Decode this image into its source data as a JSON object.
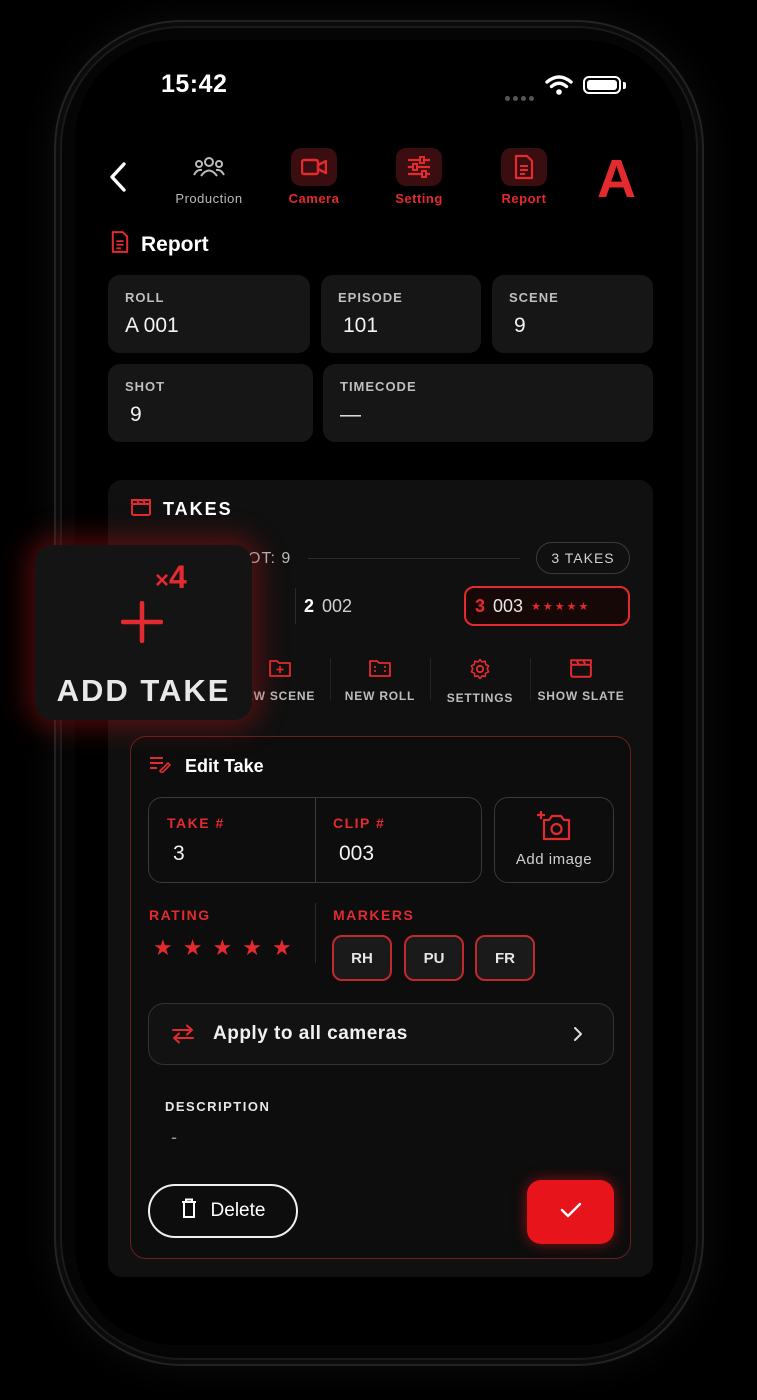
{
  "status_bar": {
    "time": "15:42"
  },
  "nav": {
    "items": [
      {
        "label": "Production",
        "active": false
      },
      {
        "label": "Camera",
        "active": true
      },
      {
        "label": "Setting",
        "active": true
      },
      {
        "label": "Report",
        "active": true
      }
    ],
    "camera_letter": "A"
  },
  "report": {
    "title": "Report",
    "fields": {
      "roll": {
        "label": "ROLL",
        "value": "A 001"
      },
      "episode": {
        "label": "EPISODE",
        "value": "101"
      },
      "scene": {
        "label": "SCENE",
        "value": "9"
      },
      "shot": {
        "label": "SHOT",
        "value": "9"
      },
      "timecode": {
        "label": "TIMECODE",
        "value": "—"
      }
    }
  },
  "takes": {
    "title": "TAKES",
    "shot_label": "OT: 9",
    "count_label": "3 TAKES",
    "list": [
      {
        "num": "2",
        "clip": "002",
        "stars": "",
        "selected": false
      },
      {
        "num": "3",
        "clip": "003",
        "stars": "★★★★★",
        "selected": true
      }
    ],
    "actions": [
      {
        "label": "EW SCENE",
        "icon": "folder-plus-icon"
      },
      {
        "label": "NEW ROLL",
        "icon": "film-folder-icon"
      },
      {
        "label": "SETTINGS",
        "icon": "gear-icon"
      },
      {
        "label": "SHOW SLATE",
        "icon": "clapperboard-icon"
      }
    ]
  },
  "edit_take": {
    "title": "Edit Take",
    "take_label": "TAKE #",
    "take_value": "3",
    "clip_label": "CLIP #",
    "clip_value": "003",
    "add_image": "Add image",
    "rating_label": "RATING",
    "rating": 5,
    "markers_label": "MARKERS",
    "markers": [
      "RH",
      "PU",
      "FR"
    ],
    "apply_label": "Apply to all cameras",
    "description_label": "DESCRIPTION",
    "description_value": "-",
    "delete_label": "Delete"
  },
  "add_take_overlay": {
    "multiplier_sign": "×",
    "multiplier": "4",
    "label": "ADD TAKE"
  },
  "colors": {
    "accent": "#e32a2f",
    "background": "#000000",
    "card": "#161616"
  }
}
